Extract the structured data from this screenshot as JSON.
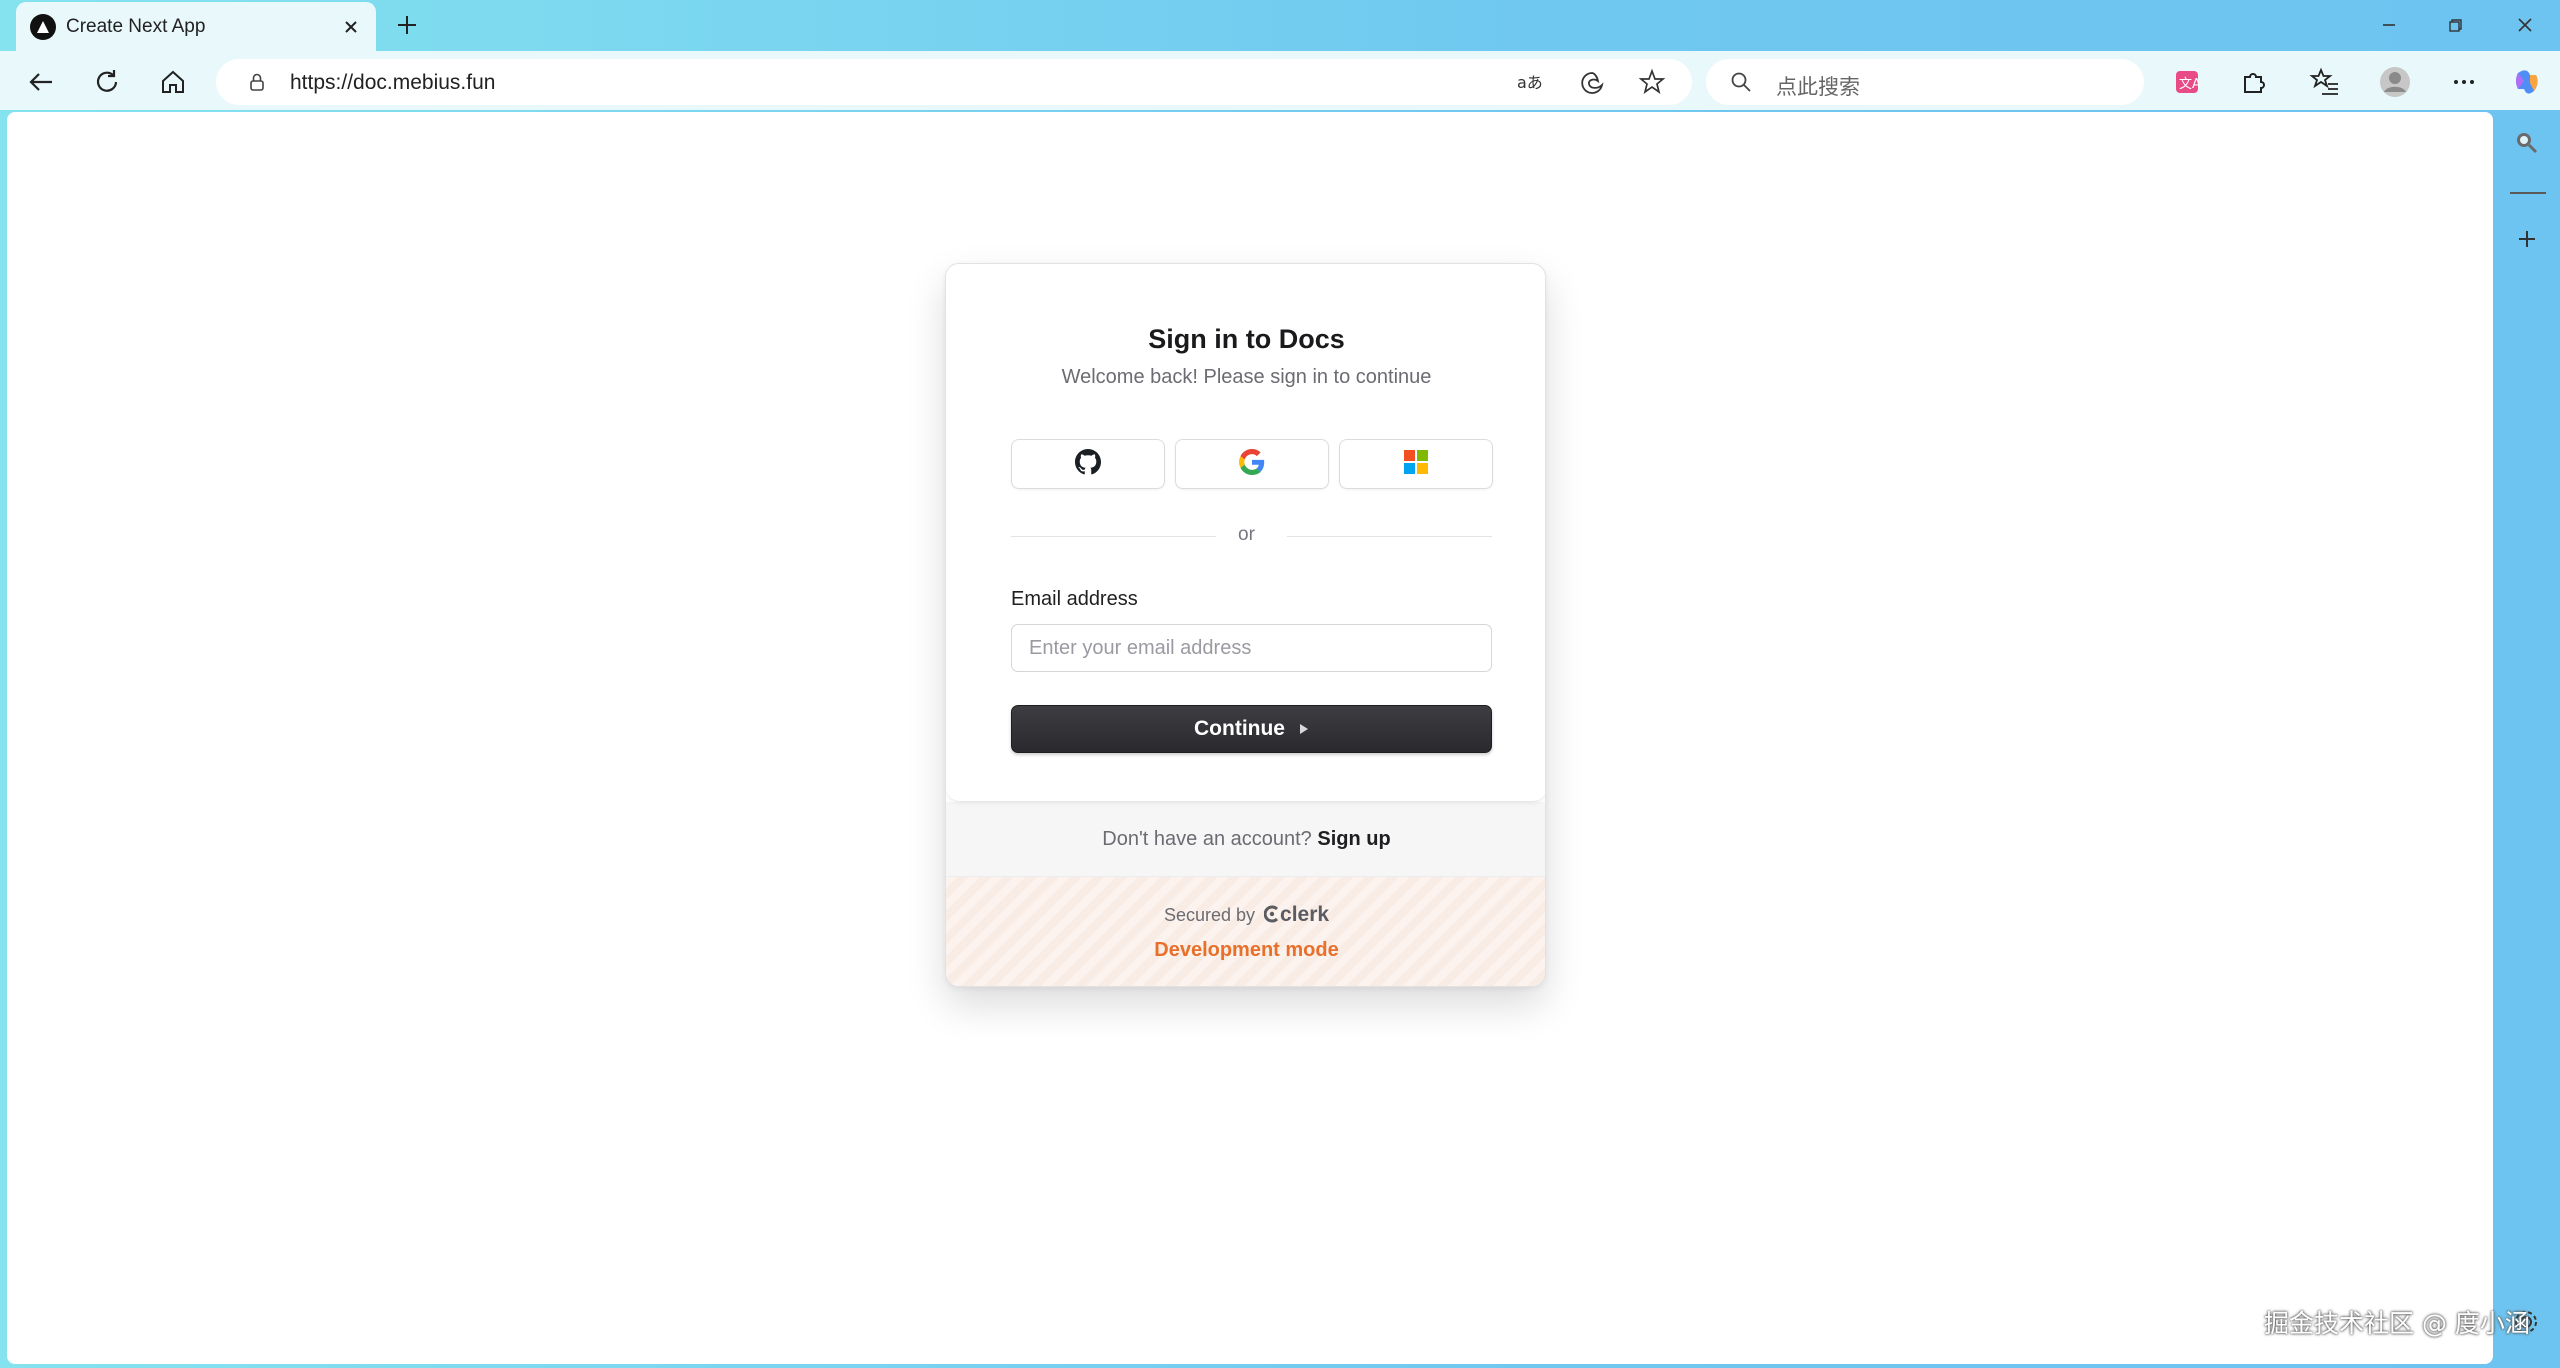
{
  "browser": {
    "tab_title": "Create Next App",
    "url": "https://doc.mebius.fun",
    "search_placeholder": "点此搜索"
  },
  "sign_in": {
    "title": "Sign in to Docs",
    "subtitle": "Welcome back! Please sign in to continue",
    "social_providers": [
      "github-icon",
      "google-icon",
      "microsoft-icon"
    ],
    "divider": "or",
    "email_label": "Email address",
    "email_placeholder": "Enter your email address",
    "continue_label": "Continue",
    "no_account_text": "Don't have an account?",
    "signup_link": "Sign up",
    "secured_by": "Secured by",
    "brand": "clerk",
    "dev_mode": "Development mode"
  },
  "watermark": "掘金技术社区 @ 度小涵",
  "colors": {
    "dev_mode": "#e8702a",
    "button": "#2f2f33",
    "browser_frame": "#6ec4f0"
  }
}
